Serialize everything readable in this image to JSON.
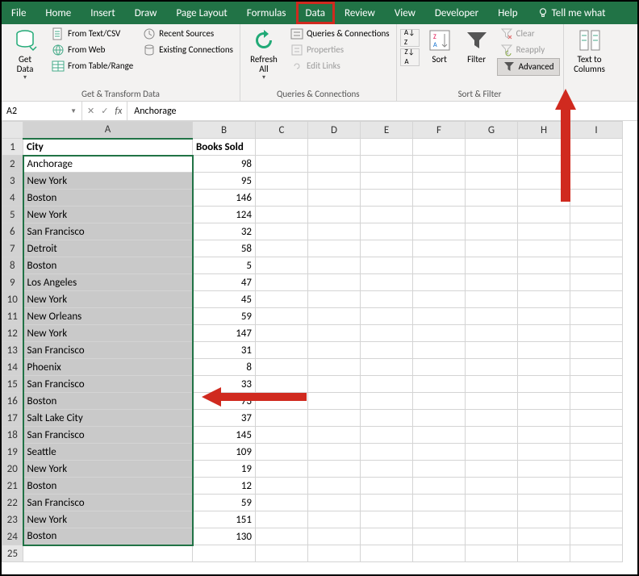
{
  "tabs": [
    "File",
    "Home",
    "Insert",
    "Draw",
    "Page Layout",
    "Formulas",
    "Data",
    "Review",
    "View",
    "Developer",
    "Help"
  ],
  "active_tab": "Data",
  "tell_me": "Tell me what",
  "ribbon": {
    "get_data": {
      "label": "Get\nData",
      "drop": "▾"
    },
    "text_csv": "From Text/CSV",
    "from_web": "From Web",
    "from_table": "From Table/Range",
    "recent": "Recent Sources",
    "existing": "Existing Connections",
    "g1": "Get & Transform Data",
    "refresh": "Refresh\nAll",
    "queries": "Queries & Connections",
    "properties": "Properties",
    "edit_links": "Edit Links",
    "g2": "Queries & Connections",
    "sort_az": "A→Z",
    "sort_za": "Z→A",
    "sort": "Sort",
    "filter": "Filter",
    "clear": "Clear",
    "reapply": "Reapply",
    "advanced": "Advanced",
    "g3": "Sort & Filter",
    "text_cols": "Text to\nColumns"
  },
  "namebox": "A2",
  "formula": "Anchorage",
  "cols": [
    "A",
    "B",
    "C",
    "D",
    "E",
    "F",
    "G",
    "H",
    "I"
  ],
  "header": {
    "c1": "City",
    "c2": "Books Sold"
  },
  "rows": [
    {
      "n": 1
    },
    {
      "n": 2,
      "a": "Anchorage",
      "b": 98
    },
    {
      "n": 3,
      "a": "New York",
      "b": 95
    },
    {
      "n": 4,
      "a": "Boston",
      "b": 146
    },
    {
      "n": 5,
      "a": "New York",
      "b": 124
    },
    {
      "n": 6,
      "a": "San Francisco",
      "b": 32
    },
    {
      "n": 7,
      "a": "Detroit",
      "b": 58
    },
    {
      "n": 8,
      "a": "Boston",
      "b": 5
    },
    {
      "n": 9,
      "a": "Los Angeles",
      "b": 47
    },
    {
      "n": 10,
      "a": "New York",
      "b": 45
    },
    {
      "n": 11,
      "a": "New Orleans",
      "b": 59
    },
    {
      "n": 12,
      "a": "New York",
      "b": 147
    },
    {
      "n": 13,
      "a": "San Francisco",
      "b": 31
    },
    {
      "n": 14,
      "a": "Phoenix",
      "b": 8
    },
    {
      "n": 15,
      "a": "San Francisco",
      "b": 33
    },
    {
      "n": 16,
      "a": "Boston",
      "b": 73
    },
    {
      "n": 17,
      "a": "Salt Lake City",
      "b": 37
    },
    {
      "n": 18,
      "a": "San Francisco",
      "b": 145
    },
    {
      "n": 19,
      "a": "Seattle",
      "b": 109
    },
    {
      "n": 20,
      "a": "New York",
      "b": 19
    },
    {
      "n": 21,
      "a": "Boston",
      "b": 12
    },
    {
      "n": 22,
      "a": "San Francisco",
      "b": 59
    },
    {
      "n": 23,
      "a": "New York",
      "b": 151
    },
    {
      "n": 24,
      "a": "Boston",
      "b": 130
    },
    {
      "n": 25
    }
  ]
}
